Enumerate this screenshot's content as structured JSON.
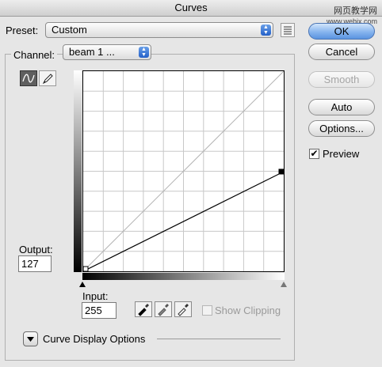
{
  "window": {
    "title": "Curves"
  },
  "watermark": {
    "line1": "网页教学网",
    "line2": "www.webjx.com"
  },
  "preset": {
    "label": "Preset:",
    "value": "Custom"
  },
  "channel": {
    "label": "Channel:",
    "value": "beam 1 ..."
  },
  "buttons": {
    "ok": "OK",
    "cancel": "Cancel",
    "smooth": "Smooth",
    "auto": "Auto",
    "options": "Options..."
  },
  "preview": {
    "label": "Preview",
    "checked": true
  },
  "output": {
    "label": "Output:",
    "value": "127"
  },
  "input": {
    "label": "Input:",
    "value": "255"
  },
  "show_clipping": {
    "label": "Show Clipping",
    "checked": false,
    "enabled": false
  },
  "curve_display_options": {
    "label": "Curve Display Options"
  },
  "curve": {
    "points_in_out": [
      [
        0,
        0
      ],
      [
        255,
        127
      ]
    ],
    "grid_divisions": 10,
    "baseline_shown": true,
    "selected_tool": "curve-tool"
  },
  "icons": [
    "curve-tool-icon",
    "pencil-tool-icon",
    "preset-menu-icon",
    "black-eyedropper-icon",
    "gray-eyedropper-icon",
    "white-eyedropper-icon",
    "disclosure-triangle-icon"
  ],
  "colors": {
    "default_button": "#6fa3e8",
    "curve": "#000000",
    "grid": "#c8c8c8"
  }
}
